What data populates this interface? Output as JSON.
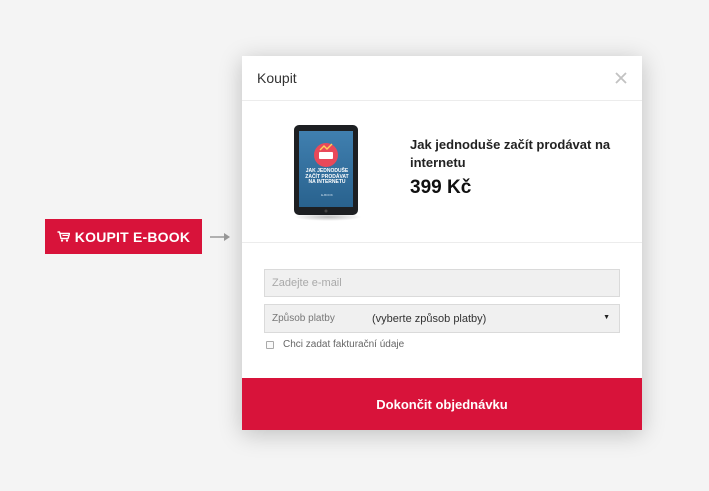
{
  "cta": {
    "icon": "cart-icon",
    "label": "KOUPIT E-BOOK",
    "color": "#d8133a"
  },
  "modal": {
    "title": "Koupit",
    "close_icon": "close-icon",
    "product": {
      "cover_title": "JAK JEDNODUŠE ZAČÍT PRODÁVAT NA INTERNETU",
      "cover_subtitle": "E-BOOK",
      "name": "Jak jednoduše začít prodávat na internetu",
      "price": "399 Kč"
    },
    "form": {
      "email_placeholder": "Zadejte e-mail",
      "email_value": "",
      "payment_label": "Způsob platby",
      "payment_value": "(vyberte způsob platby)",
      "invoice_checkbox_label": "Chci zadat fakturační údaje",
      "invoice_checked": false
    },
    "submit_label": "Dokončit objednávku",
    "accent_color": "#d8133a"
  }
}
